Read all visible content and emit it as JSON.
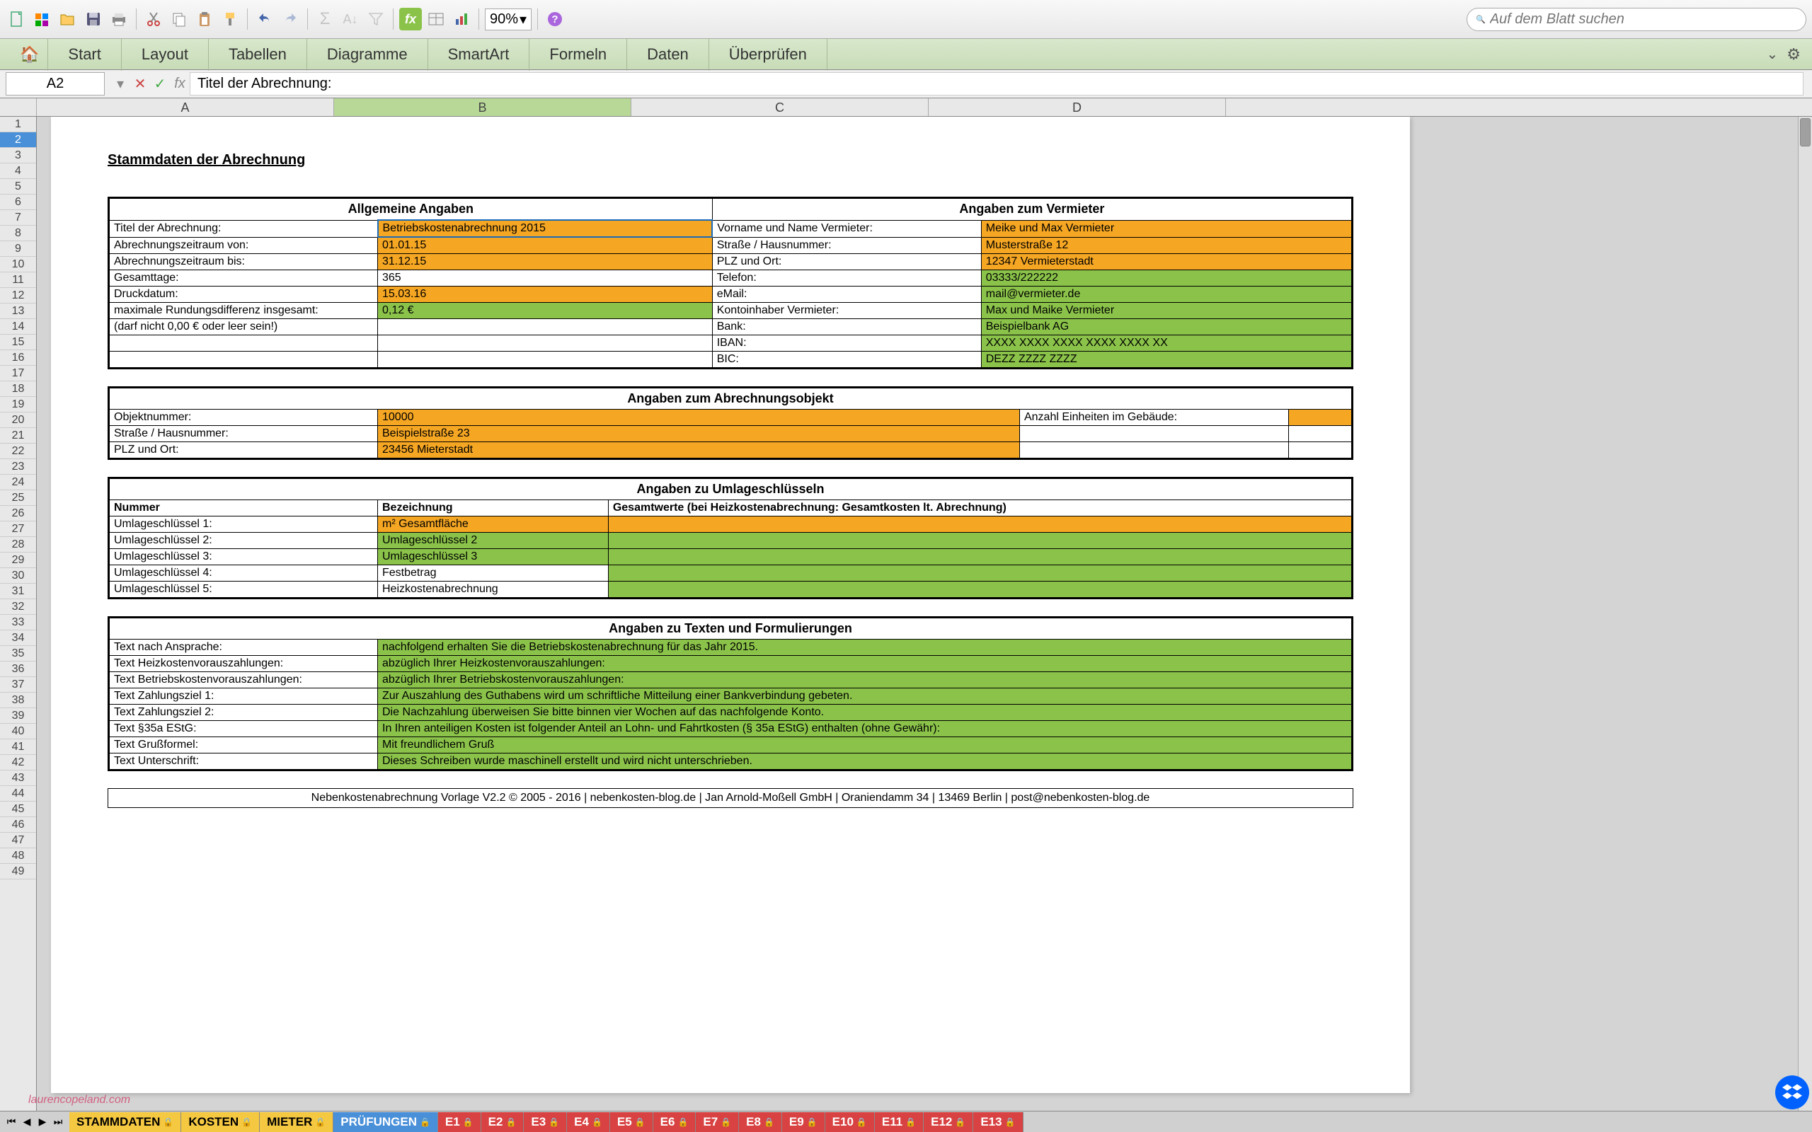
{
  "toolbar": {
    "zoom": "90%",
    "search_placeholder": "Auf dem Blatt suchen"
  },
  "ribbon": {
    "tabs": [
      "Start",
      "Layout",
      "Tabellen",
      "Diagramme",
      "SmartArt",
      "Formeln",
      "Daten",
      "Überprüfen"
    ]
  },
  "formula_bar": {
    "cell_ref": "A2",
    "formula": "Titel der Abrechnung:"
  },
  "columns": [
    "A",
    "B",
    "C",
    "D"
  ],
  "doc": {
    "title": "Stammdaten der Abrechnung",
    "section1": {
      "left_header": "Allgemeine Angaben",
      "right_header": "Angaben zum Vermieter",
      "left_rows": [
        {
          "label": "Titel der Abrechnung:",
          "value": "Betriebskostenabrechnung 2015",
          "color": "orange",
          "selected": true
        },
        {
          "label": "Abrechnungszeitraum von:",
          "value": "01.01.15",
          "color": "orange"
        },
        {
          "label": "Abrechnungszeitraum bis:",
          "value": "31.12.15",
          "color": "orange"
        },
        {
          "label": "Gesamttage:",
          "value": "365",
          "color": ""
        },
        {
          "label": "Druckdatum:",
          "value": "15.03.16",
          "color": "orange"
        },
        {
          "label": "maximale Rundungsdifferenz insgesamt:",
          "value": "0,12 €",
          "color": "green"
        },
        {
          "label": "(darf nicht 0,00 € oder leer sein!)",
          "value": "",
          "color": ""
        }
      ],
      "right_rows": [
        {
          "label": "Vorname und Name Vermieter:",
          "value": "Meike und Max Vermieter",
          "color": "orange"
        },
        {
          "label": "Straße / Hausnummer:",
          "value": "Musterstraße 12",
          "color": "orange"
        },
        {
          "label": "PLZ und Ort:",
          "value": "12347 Vermieterstadt",
          "color": "orange"
        },
        {
          "label": "Telefon:",
          "value": "03333/222222",
          "color": "green"
        },
        {
          "label": "eMail:",
          "value": "mail@vermieter.de",
          "color": "green"
        },
        {
          "label": "Kontoinhaber Vermieter:",
          "value": "Max und Maike Vermieter",
          "color": "green"
        },
        {
          "label": "Bank:",
          "value": "Beispielbank AG",
          "color": "green"
        },
        {
          "label": "IBAN:",
          "value": "XXXX XXXX XXXX XXXX XXXX XX",
          "color": "green"
        },
        {
          "label": "BIC:",
          "value": "DEZZ ZZZZ ZZZZ",
          "color": "green"
        }
      ]
    },
    "section2": {
      "header": "Angaben zum Abrechnungsobjekt",
      "left_rows": [
        {
          "label": "Objektnummer:",
          "value": "10000",
          "color": "orange"
        },
        {
          "label": "Straße / Hausnummer:",
          "value": "Beispielstraße 23",
          "color": "orange"
        },
        {
          "label": "PLZ und Ort:",
          "value": "23456 Mieterstadt",
          "color": "orange"
        }
      ],
      "right_rows": [
        {
          "label": "Anzahl Einheiten im Gebäude:",
          "value": "",
          "color": "orange"
        }
      ]
    },
    "section3": {
      "header": "Angaben zu Umlageschlüsseln",
      "col1": "Nummer",
      "col2": "Bezeichnung",
      "col3": "Gesamtwerte (bei Heizkostenabrechnung: Gesamtkosten lt. Abrechnung)",
      "rows": [
        {
          "label": "Umlageschlüssel 1:",
          "value": "m² Gesamtfläche",
          "color": "orange",
          "vcolor": "orange"
        },
        {
          "label": "Umlageschlüssel 2:",
          "value": "Umlageschlüssel 2",
          "color": "green",
          "vcolor": "green"
        },
        {
          "label": "Umlageschlüssel 3:",
          "value": "Umlageschlüssel 3",
          "color": "green",
          "vcolor": "green"
        },
        {
          "label": "Umlageschlüssel 4:",
          "value": "Festbetrag",
          "color": "",
          "vcolor": "green"
        },
        {
          "label": "Umlageschlüssel 5:",
          "value": "Heizkostenabrechnung",
          "color": "",
          "vcolor": "green"
        }
      ]
    },
    "section4": {
      "header": "Angaben zu Texten und Formulierungen",
      "rows": [
        {
          "label": "Text nach Ansprache:",
          "value": "nachfolgend erhalten Sie die Betriebskostenabrechnung für das Jahr 2015."
        },
        {
          "label": "Text Heizkostenvorauszahlungen:",
          "value": "abzüglich Ihrer Heizkostenvorauszahlungen:"
        },
        {
          "label": "Text Betriebskostenvorauszahlungen:",
          "value": "abzüglich Ihrer Betriebskostenvorauszahlungen:"
        },
        {
          "label": "Text Zahlungsziel 1:",
          "value": "Zur Auszahlung des Guthabens wird um schriftliche Mitteilung einer Bankverbindung gebeten."
        },
        {
          "label": "Text Zahlungsziel 2:",
          "value": "Die Nachzahlung überweisen Sie bitte binnen vier Wochen auf das nachfolgende Konto."
        },
        {
          "label": "Text §35a EStG:",
          "value": "In Ihren anteiligen Kosten ist folgender Anteil an Lohn- und Fahrtkosten (§ 35a EStG) enthalten (ohne Gewähr):"
        },
        {
          "label": "Text Grußformel:",
          "value": "Mit freundlichem Gruß"
        },
        {
          "label": "Text Unterschrift:",
          "value": "Dieses Schreiben wurde maschinell erstellt und wird nicht unterschrieben."
        }
      ]
    },
    "footer": "Nebenkostenabrechnung Vorlage V2.2 © 2005 - 2016 | nebenkosten-blog.de | Jan Arnold-Moßell GmbH | Oraniendamm 34 | 13469 Berlin | post@nebenkosten-blog.de"
  },
  "tabs": {
    "list": [
      {
        "name": "STAMMDATEN",
        "color": "st-yellow"
      },
      {
        "name": "KOSTEN",
        "color": "st-yellow"
      },
      {
        "name": "MIETER",
        "color": "st-yellow"
      },
      {
        "name": "PRÜFUNGEN",
        "color": "st-blue"
      },
      {
        "name": "E1",
        "color": "st-red"
      },
      {
        "name": "E2",
        "color": "st-red"
      },
      {
        "name": "E3",
        "color": "st-red"
      },
      {
        "name": "E4",
        "color": "st-red"
      },
      {
        "name": "E5",
        "color": "st-red"
      },
      {
        "name": "E6",
        "color": "st-red"
      },
      {
        "name": "E7",
        "color": "st-red"
      },
      {
        "name": "E8",
        "color": "st-red"
      },
      {
        "name": "E9",
        "color": "st-red"
      },
      {
        "name": "E10",
        "color": "st-red"
      },
      {
        "name": "E11",
        "color": "st-red"
      },
      {
        "name": "E12",
        "color": "st-red"
      },
      {
        "name": "E13",
        "color": "st-red"
      }
    ]
  },
  "watermark": "laurencopeland.com"
}
